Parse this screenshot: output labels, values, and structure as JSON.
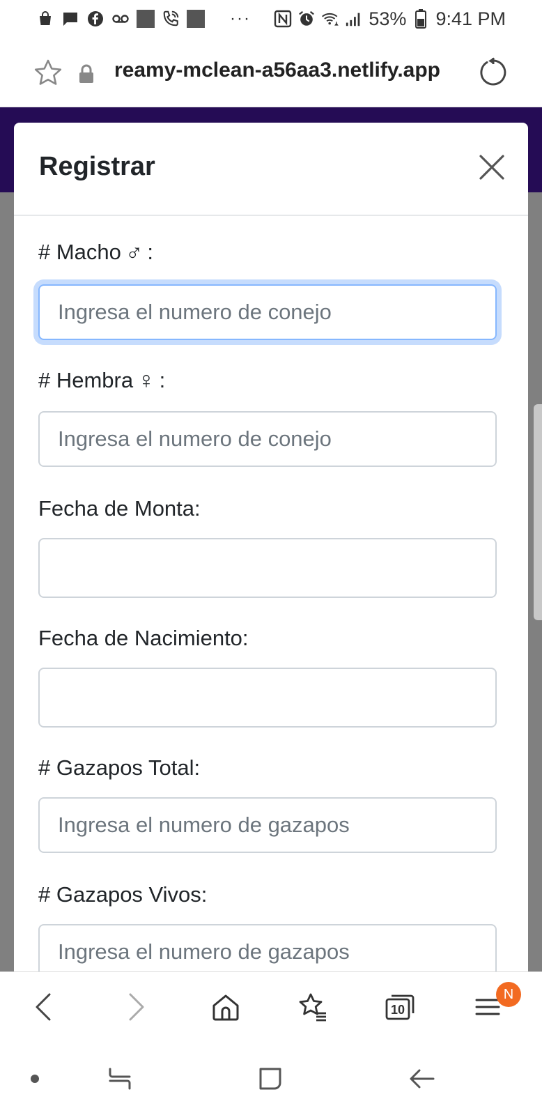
{
  "status_bar": {
    "battery": "53%",
    "time": "9:41 PM",
    "more": "···"
  },
  "browser": {
    "url": "reamy-mclean-a56aa3.netlify.app"
  },
  "colors": {
    "header_purple": "#250c55",
    "overlay_gray": "#808080",
    "focus_blue": "#86b7fe",
    "badge_orange": "#f26a21"
  },
  "modal": {
    "title": "Registrar",
    "fields": [
      {
        "label_prefix": "# Macho",
        "symbol": "♂",
        "label_suffix": ":",
        "placeholder": "Ingresa el numero de conejo",
        "value": ""
      },
      {
        "label_prefix": "# Hembra",
        "symbol": "♀",
        "label_suffix": ":",
        "placeholder": "Ingresa el numero de conejo",
        "value": ""
      },
      {
        "label": "Fecha de Monta:",
        "value": ""
      },
      {
        "label": "Fecha de Nacimiento:",
        "value": ""
      },
      {
        "label": "# Gazapos Total:",
        "placeholder": "Ingresa el numero de gazapos",
        "value": ""
      },
      {
        "label": "# Gazapos Vivos:",
        "placeholder": "Ingresa el numero de gazapos",
        "value": ""
      }
    ]
  },
  "toolbar": {
    "tabs_count": "10",
    "notification_badge": "N"
  }
}
